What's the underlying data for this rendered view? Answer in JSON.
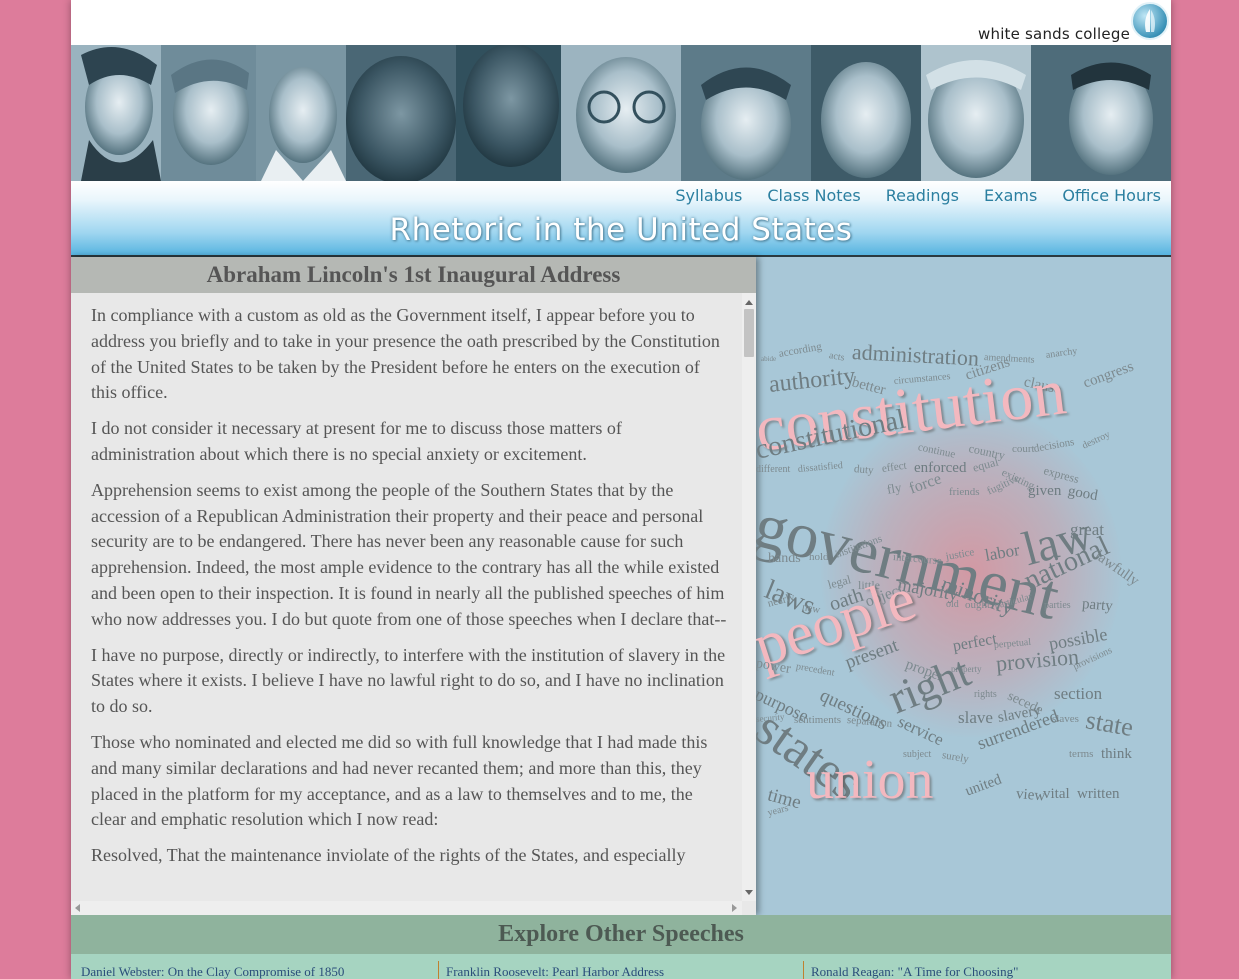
{
  "brand": {
    "name": "white sands college",
    "logo_icon": "sail-logo-icon"
  },
  "nav": {
    "items": [
      "Syllabus",
      "Class Notes",
      "Readings",
      "Exams",
      "Office Hours"
    ]
  },
  "site_title": "Rhetoric in the United States",
  "speech": {
    "title": "Abraham Lincoln's 1st Inaugural Address",
    "paragraphs": [
      "In compliance with a custom as old as the Government itself, I appear before you to address you briefly and to take in your presence the oath prescribed by the Constitution of the United States to be taken by the President before he enters on the execution of this office.",
      "I do not consider it necessary at present for me to discuss those matters of administration about which there is no special anxiety or excitement.",
      "Apprehension seems to exist among the people of the Southern States that by the accession of a Republican Administration their property and their peace and personal security are to be endangered. There has never been any reasonable cause for such apprehension. Indeed, the most ample evidence to the contrary has all the while existed and been open to their inspection. It is found in nearly all the published speeches of him who now addresses you. I do but quote from one of those speeches when I declare that--",
      "I have no purpose, directly or indirectly, to interfere with the institution of slavery in the States where it exists. I believe I have no lawful right to do so, and I have no inclination to do so.",
      "Those who nominated and elected me did so with full knowledge that I had made this and many similar declarations and had never recanted them; and more than this, they placed in the platform for my acceptance, and as a law to themselves and to me, the clear and emphatic resolution which I now read:",
      "Resolved, That the maintenance inviolate of the rights of the States, and especially"
    ]
  },
  "word_cloud": {
    "colors": {
      "large": "#f3b8bf",
      "medium": "#6f7d82",
      "small": "#7d8a8f"
    },
    "words": [
      {
        "t": "abide"
      },
      {
        "t": "according"
      },
      {
        "t": "acts"
      },
      {
        "t": "administration"
      },
      {
        "t": "amendments"
      },
      {
        "t": "anarchy"
      },
      {
        "t": "authority"
      },
      {
        "t": "better"
      },
      {
        "t": "circumstances"
      },
      {
        "t": "citizens"
      },
      {
        "t": "clause"
      },
      {
        "t": "congress"
      },
      {
        "t": "constitution"
      },
      {
        "t": "constitutional"
      },
      {
        "t": "continue"
      },
      {
        "t": "country"
      },
      {
        "t": "court"
      },
      {
        "t": "decisions"
      },
      {
        "t": "destroy"
      },
      {
        "t": "different"
      },
      {
        "t": "dissatisfied"
      },
      {
        "t": "duty"
      },
      {
        "t": "effect"
      },
      {
        "t": "enforced"
      },
      {
        "t": "equal"
      },
      {
        "t": "existing"
      },
      {
        "t": "express"
      },
      {
        "t": "government"
      },
      {
        "t": "fly"
      },
      {
        "t": "force"
      },
      {
        "t": "friends"
      },
      {
        "t": "fugitive"
      },
      {
        "t": "given"
      },
      {
        "t": "good"
      },
      {
        "t": "great"
      },
      {
        "t": "hands"
      },
      {
        "t": "hold"
      },
      {
        "t": "institutions"
      },
      {
        "t": "intercourse"
      },
      {
        "t": "justice"
      },
      {
        "t": "labor"
      },
      {
        "t": "law"
      },
      {
        "t": "lawfully"
      },
      {
        "t": "laws"
      },
      {
        "t": "legal"
      },
      {
        "t": "little"
      },
      {
        "t": "majority"
      },
      {
        "t": "minority"
      },
      {
        "t": "national"
      },
      {
        "t": "nearly"
      },
      {
        "t": "new"
      },
      {
        "t": "oath"
      },
      {
        "t": "object"
      },
      {
        "t": "old"
      },
      {
        "t": "ought"
      },
      {
        "t": "particular"
      },
      {
        "t": "parties"
      },
      {
        "t": "party"
      },
      {
        "t": "people"
      },
      {
        "t": "perfect"
      },
      {
        "t": "perpetual"
      },
      {
        "t": "possible"
      },
      {
        "t": "power"
      },
      {
        "t": "precedent"
      },
      {
        "t": "present"
      },
      {
        "t": "proper"
      },
      {
        "t": "property"
      },
      {
        "t": "provision"
      },
      {
        "t": "provisions"
      },
      {
        "t": "purpose"
      },
      {
        "t": "questions"
      },
      {
        "t": "right"
      },
      {
        "t": "rights"
      },
      {
        "t": "secede"
      },
      {
        "t": "section"
      },
      {
        "t": "security"
      },
      {
        "t": "sentiments"
      },
      {
        "t": "separation"
      },
      {
        "t": "service"
      },
      {
        "t": "slave"
      },
      {
        "t": "slavery"
      },
      {
        "t": "slaves"
      },
      {
        "t": "state"
      },
      {
        "t": "states"
      },
      {
        "t": "subject"
      },
      {
        "t": "surely"
      },
      {
        "t": "surrendered"
      },
      {
        "t": "terms"
      },
      {
        "t": "think"
      },
      {
        "t": "union"
      },
      {
        "t": "time"
      },
      {
        "t": "united"
      },
      {
        "t": "view"
      },
      {
        "t": "vital"
      },
      {
        "t": "written"
      },
      {
        "t": "years"
      }
    ]
  },
  "explore": {
    "title": "Explore Other Speeches",
    "links": [
      "Daniel Webster: On the Clay Compromise of 1850",
      "Franklin Roosevelt: Pearl Harbor Address",
      "Ronald Reagan: \"A Time for Choosing\""
    ]
  }
}
